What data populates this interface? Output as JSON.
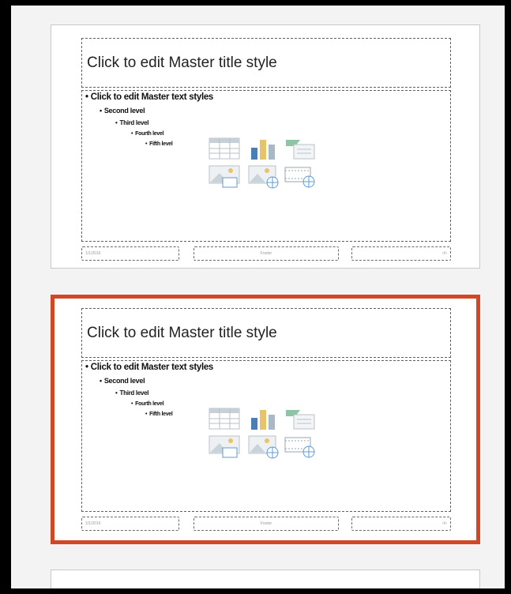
{
  "slides": [
    {
      "title": "Click to edit Master title style",
      "levels": [
        "Click to edit Master text styles",
        "Second level",
        "Third level",
        "Fourth level",
        "Fifth level"
      ],
      "footer_left": "1/1/2016",
      "footer_center": "Footer",
      "footer_right": "‹#›",
      "selected": false
    },
    {
      "title": "Click to edit Master title style",
      "levels": [
        "Click to edit Master text styles",
        "Second level",
        "Third level",
        "Fourth level",
        "Fifth level"
      ],
      "footer_left": "1/1/2016",
      "footer_center": "Footer",
      "footer_right": "‹#›",
      "selected": true
    }
  ],
  "colors": {
    "selection_border": "#d24726",
    "pane_background": "#f3f3f3"
  },
  "content_icons": [
    "table-icon",
    "chart-icon",
    "smartart-icon",
    "picture-icon",
    "online-picture-icon",
    "video-icon"
  ]
}
